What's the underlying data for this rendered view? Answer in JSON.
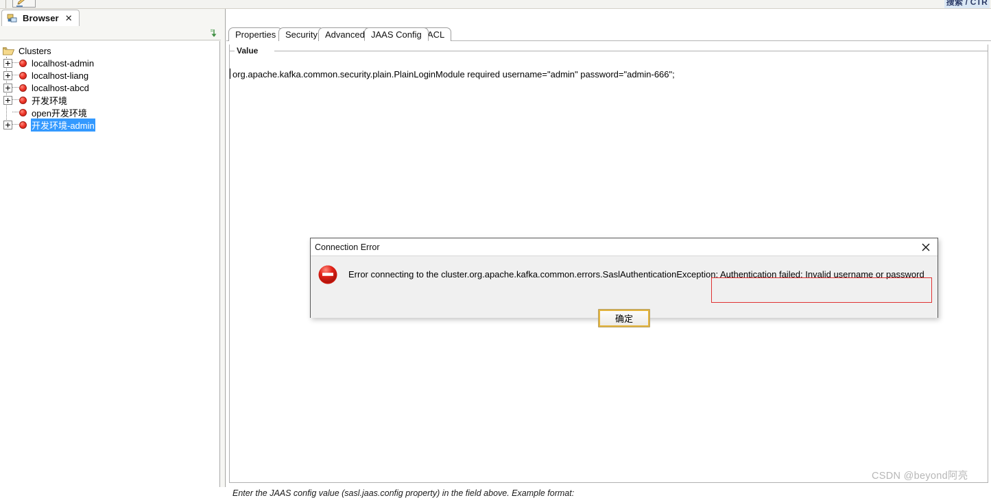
{
  "toolbar": {
    "edit_icon": "pencil-icon",
    "top_right_clipped_text": "搜索 / CTR"
  },
  "left_view": {
    "tab": {
      "label": "Browser",
      "icon": "browser-icon",
      "close": "✕"
    },
    "collapse_all_icon": "collapse-all-icon",
    "tree": {
      "root": {
        "label": "Clusters",
        "icon": "folder-icon"
      },
      "nodes": [
        {
          "label": "localhost-admin",
          "expandable": true,
          "selected": false
        },
        {
          "label": "localhost-liang",
          "expandable": true,
          "selected": false
        },
        {
          "label": "localhost-abcd",
          "expandable": true,
          "selected": false
        },
        {
          "label": "开发环境",
          "expandable": true,
          "selected": false
        },
        {
          "label": "open开发环境",
          "expandable": false,
          "selected": false
        },
        {
          "label": "开发环境-admin",
          "expandable": true,
          "selected": true
        }
      ]
    }
  },
  "editor": {
    "tabs": [
      {
        "label": "Properties",
        "active": false
      },
      {
        "label": "Security",
        "active": false
      },
      {
        "label": "Advanced",
        "active": false
      },
      {
        "label": "JAAS Config",
        "active": true
      },
      {
        "label": "ACL",
        "active": false
      }
    ],
    "group_title": "Value",
    "value": "org.apache.kafka.common.security.plain.PlainLoginModule required username=\"admin\" password=\"admin-666\";",
    "hint": "Enter the JAAS config value (sasl.jaas.config property) in the field above. Example format:"
  },
  "dialog": {
    "title": "Connection Error",
    "close_icon": "close-icon",
    "error_icon": "error-stop-icon",
    "message": "Error connecting to the cluster.org.apache.kafka.common.errors.SaslAuthenticationException: Authentication failed: Invalid username or password",
    "highlighted_fragment": "Authentication failed: Invalid username or password",
    "ok_label": "确定"
  },
  "watermark": "CSDN @beyond阿亮",
  "colors": {
    "selection_blue": "#3399ff",
    "error_red": "#e03030",
    "bullet_red": "#f0372b",
    "focus_gold": "#e2b33c"
  }
}
